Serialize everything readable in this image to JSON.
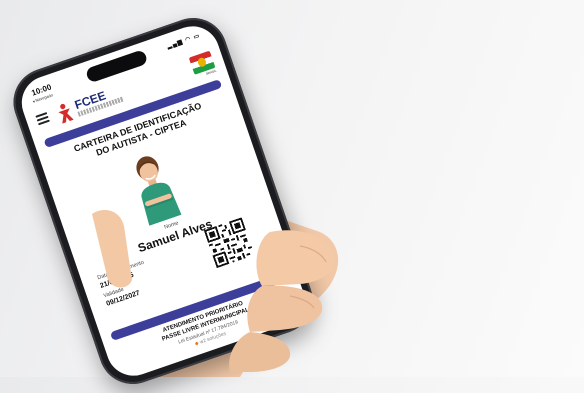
{
  "phone": {
    "status": {
      "time": "10:00",
      "back_label": "◂ Navegado"
    },
    "app": {
      "logo_text": "FCEE",
      "flag_caption": "BRASIL",
      "card_title_line1": "CARTEIRA DE IDENTIFICAÇÃO",
      "card_title_line2": "DO AUTISTA - CIPTEA",
      "name_label": "Nome",
      "name_value": "Samuel Alves",
      "birth_label": "Data de nascimento",
      "birth_value": "21/06/2015",
      "validity_label": "Validade",
      "validity_value": "09/12/2027",
      "footer_line1": "ATENDIMENTO PRIORITÁRIO",
      "footer_line2": "PASSE LIVRE INTERMUNICIPAL",
      "law_text": "Lei Estadual nº 17.784/2019",
      "brand_text": "w2 soluções"
    }
  },
  "colors": {
    "band": "#3d3e9a",
    "brand_blue": "#1e2a78",
    "brand_red": "#d42b2b",
    "shirt": "#2e9a7a"
  }
}
